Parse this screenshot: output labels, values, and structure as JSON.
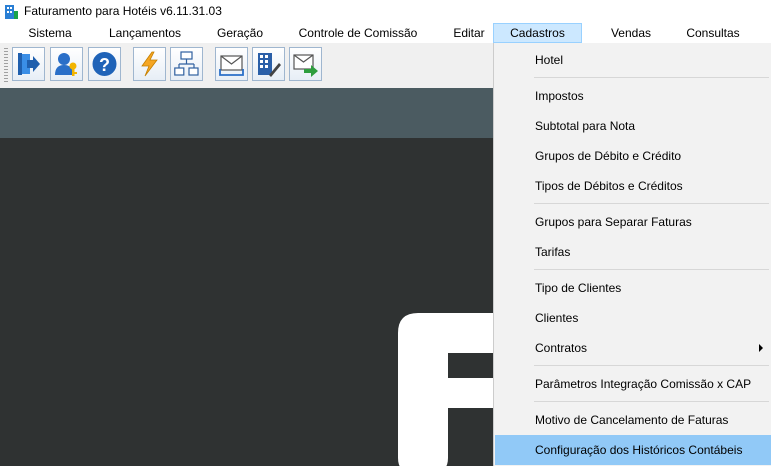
{
  "window": {
    "title": "Faturamento para Hotéis v6.11.31.03"
  },
  "menubar": {
    "items": [
      {
        "label": "Sistema"
      },
      {
        "label": "Lançamentos"
      },
      {
        "label": "Geração"
      },
      {
        "label": "Controle de Comissão"
      },
      {
        "label": "Editar"
      },
      {
        "label": "Cadastros"
      },
      {
        "label": "Vendas"
      },
      {
        "label": "Consultas"
      }
    ],
    "active_index": 5
  },
  "toolbar": {
    "buttons": [
      {
        "icon": "exit-door-icon"
      },
      {
        "icon": "user-key-icon"
      },
      {
        "icon": "help-icon"
      },
      {
        "icon": "lightning-icon"
      },
      {
        "icon": "network-diagram-icon"
      },
      {
        "icon": "envelope-tray-icon"
      },
      {
        "icon": "building-pen-icon"
      },
      {
        "icon": "envelope-arrow-icon"
      }
    ]
  },
  "cadastros_menu": {
    "items": [
      {
        "label": "Hotel"
      },
      {
        "label": "Impostos"
      },
      {
        "label": "Subtotal para Nota"
      },
      {
        "label": "Grupos de Débito e Crédito"
      },
      {
        "label": "Tipos de Débitos e Créditos"
      },
      {
        "label": "Grupos para Separar Faturas"
      },
      {
        "label": "Tarifas"
      },
      {
        "label": "Tipo de Clientes"
      },
      {
        "label": "Clientes"
      },
      {
        "label": "Contratos",
        "has_submenu": true
      },
      {
        "label": "Parâmetros Integração Comissão x CAP"
      },
      {
        "label": "Motivo de Cancelamento de Faturas"
      },
      {
        "label": "Configuração dos Históricos Contábeis",
        "highlighted": true
      }
    ]
  },
  "colors": {
    "menu_highlight": "#91c9f7",
    "active_menu": "#cce8ff",
    "workspace": "#2f3232",
    "banner": "#4b5b61"
  }
}
